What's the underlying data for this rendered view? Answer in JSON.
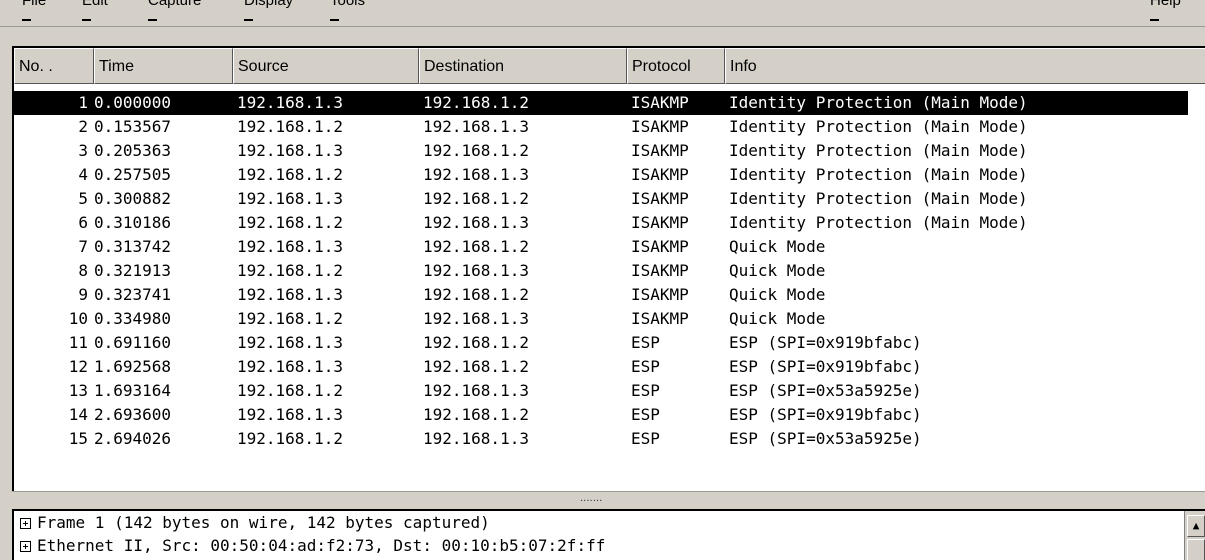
{
  "menubar": {
    "items": [
      "File",
      "Edit",
      "Capture",
      "Display",
      "Tools"
    ],
    "help": "Help"
  },
  "packet_list": {
    "columns": [
      "No. .",
      "Time",
      "Source",
      "Destination",
      "Protocol",
      "Info"
    ],
    "rows": [
      {
        "no": "1",
        "time": "0.000000",
        "src": "192.168.1.3",
        "dst": "192.168.1.2",
        "proto": "ISAKMP",
        "info": "Identity Protection (Main Mode)",
        "selected": true
      },
      {
        "no": "2",
        "time": "0.153567",
        "src": "192.168.1.2",
        "dst": "192.168.1.3",
        "proto": "ISAKMP",
        "info": "Identity Protection (Main Mode)"
      },
      {
        "no": "3",
        "time": "0.205363",
        "src": "192.168.1.3",
        "dst": "192.168.1.2",
        "proto": "ISAKMP",
        "info": "Identity Protection (Main Mode)"
      },
      {
        "no": "4",
        "time": "0.257505",
        "src": "192.168.1.2",
        "dst": "192.168.1.3",
        "proto": "ISAKMP",
        "info": "Identity Protection (Main Mode)"
      },
      {
        "no": "5",
        "time": "0.300882",
        "src": "192.168.1.3",
        "dst": "192.168.1.2",
        "proto": "ISAKMP",
        "info": "Identity Protection (Main Mode)"
      },
      {
        "no": "6",
        "time": "0.310186",
        "src": "192.168.1.2",
        "dst": "192.168.1.3",
        "proto": "ISAKMP",
        "info": "Identity Protection (Main Mode)"
      },
      {
        "no": "7",
        "time": "0.313742",
        "src": "192.168.1.3",
        "dst": "192.168.1.2",
        "proto": "ISAKMP",
        "info": "Quick Mode"
      },
      {
        "no": "8",
        "time": "0.321913",
        "src": "192.168.1.2",
        "dst": "192.168.1.3",
        "proto": "ISAKMP",
        "info": "Quick Mode"
      },
      {
        "no": "9",
        "time": "0.323741",
        "src": "192.168.1.3",
        "dst": "192.168.1.2",
        "proto": "ISAKMP",
        "info": "Quick Mode"
      },
      {
        "no": "10",
        "time": "0.334980",
        "src": "192.168.1.2",
        "dst": "192.168.1.3",
        "proto": "ISAKMP",
        "info": "Quick Mode"
      },
      {
        "no": "11",
        "time": "0.691160",
        "src": "192.168.1.3",
        "dst": "192.168.1.2",
        "proto": "ESP",
        "info": "ESP (SPI=0x919bfabc)"
      },
      {
        "no": "12",
        "time": "1.692568",
        "src": "192.168.1.3",
        "dst": "192.168.1.2",
        "proto": "ESP",
        "info": "ESP (SPI=0x919bfabc)"
      },
      {
        "no": "13",
        "time": "1.693164",
        "src": "192.168.1.2",
        "dst": "192.168.1.3",
        "proto": "ESP",
        "info": "ESP (SPI=0x53a5925e)"
      },
      {
        "no": "14",
        "time": "2.693600",
        "src": "192.168.1.3",
        "dst": "192.168.1.2",
        "proto": "ESP",
        "info": "ESP (SPI=0x919bfabc)"
      },
      {
        "no": "15",
        "time": "2.694026",
        "src": "192.168.1.2",
        "dst": "192.168.1.3",
        "proto": "ESP",
        "info": "ESP (SPI=0x53a5925e)"
      }
    ]
  },
  "splitter": {
    "grip": "......."
  },
  "details": {
    "lines": [
      "Frame 1 (142 bytes on wire, 142 bytes captured)",
      "Ethernet II, Src: 00:50:04:ad:f2:73, Dst: 00:10:b5:07:2f:ff"
    ]
  },
  "colors": {
    "selection_bg": "#000000",
    "selection_fg": "#ffffff",
    "chrome": "#d4d0c8"
  }
}
